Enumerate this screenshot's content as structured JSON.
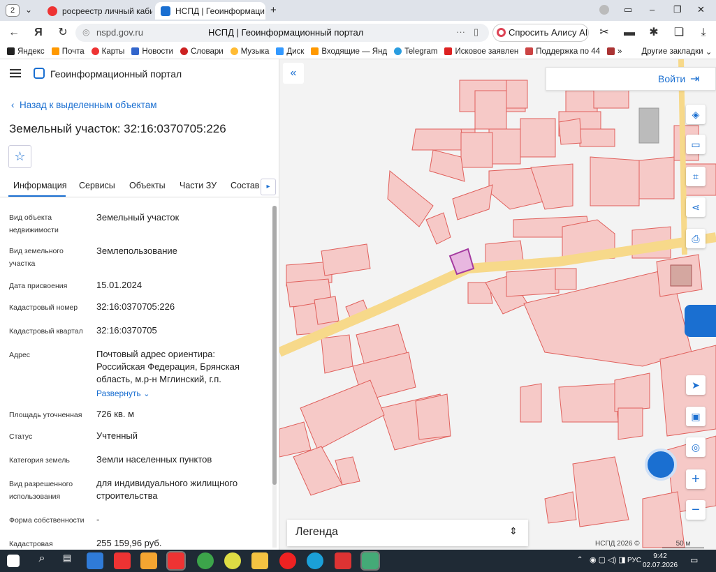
{
  "browser": {
    "tab_count": "2",
    "tabs": [
      {
        "title": "росреестр личный кабин",
        "active": false
      },
      {
        "title": "НСПД | Геоинформаци",
        "active": true
      }
    ],
    "url": "nspd.gov.ru",
    "page_title": "НСПД | Геоинформационный портал",
    "alice_label": "Спросить Алису AI",
    "bookmarks": [
      "Яндекс",
      "Почта",
      "Карты",
      "Новости",
      "Словари",
      "Музыка",
      "Диск",
      "Входящие — Янд",
      "Telegram",
      "Исковое заявлен",
      "Поддержка по 44",
      "»"
    ],
    "other_bookmarks": "Другие закладки"
  },
  "sidebar": {
    "portal_title": "Геоинформационный портал",
    "back_link": "Назад к выделенным объектам",
    "object_title": "Земельный участок: 32:16:0370705:226",
    "tabs": [
      "Информация",
      "Сервисы",
      "Объекты",
      "Части ЗУ",
      "Состав"
    ],
    "rows": [
      {
        "label": "Вид объекта недвижимости",
        "value": "Земельный участок"
      },
      {
        "label": "Вид земельного участка",
        "value": "Землепользование"
      },
      {
        "label": "Дата присвоения",
        "value": "15.01.2024"
      },
      {
        "label": "Кадастровый номер",
        "value": "32:16:0370705:226"
      },
      {
        "label": "Кадастровый квартал",
        "value": "32:16:0370705"
      },
      {
        "label": "Адрес",
        "value": "Почтовый адрес ориентира: Российская Федерация, Брянская область, м.р-н Мглинский, г.п."
      },
      {
        "label": "Площадь уточненная",
        "value": "726 кв. м"
      },
      {
        "label": "Статус",
        "value": "Учтенный"
      },
      {
        "label": "Категория земель",
        "value": "Земли населенных пунктов"
      },
      {
        "label": "Вид разрешенного использования",
        "value": "для индивидуального жилищного строительства"
      },
      {
        "label": "Форма собственности",
        "value": "-"
      },
      {
        "label": "Кадастровая",
        "value": "255 159,96 руб."
      }
    ],
    "expand_label": "Развернуть"
  },
  "map": {
    "login_label": "Войти",
    "legend_label": "Легенда",
    "copyright": "НСПД 2026 ©",
    "scale": "50 м",
    "colors": {
      "parcel_fill": "#f6c9c7",
      "parcel_stroke": "#e0605c",
      "road": "#f7d98a",
      "selected": "#c94fc4"
    }
  },
  "taskbar": {
    "lang": "РУС",
    "time": "9:42",
    "date": "02.07.2026"
  }
}
